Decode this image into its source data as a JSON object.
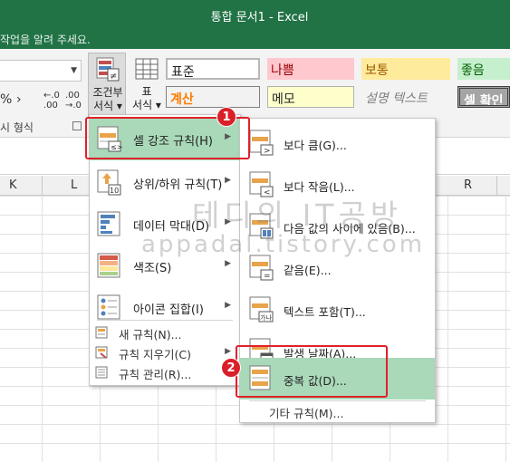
{
  "window": {
    "title": "통합 문서1 - Excel"
  },
  "tellme": {
    "text": "작업을 알려 주세요."
  },
  "ribbon": {
    "number_group_label": "시 형식",
    "percent_symbol": "%",
    "comma_symbol": "›",
    "increase_decimal": "←.0\n.00",
    "decrease_decimal": ".00\n→.0",
    "conditional_format_label": "조건부\n서식 ▾",
    "format_table_label": "표\n서식 ▾",
    "styles": [
      {
        "label": "표준"
      },
      {
        "label": "나쁨"
      },
      {
        "label": "보통"
      },
      {
        "label": "좋음"
      },
      {
        "label": "계산"
      },
      {
        "label": "메모"
      },
      {
        "label": "설명 텍스트"
      },
      {
        "label": "셀 확인"
      }
    ]
  },
  "columns": {
    "k": "K",
    "l": "L",
    "r": "R"
  },
  "menu_main": {
    "items": [
      {
        "label": "셀 강조 규칙(H)"
      },
      {
        "label": "상위/하위 규칙(T)"
      },
      {
        "label": "데이터 막대(D)"
      },
      {
        "label": "색조(S)"
      },
      {
        "label": "아이콘 집합(I)"
      }
    ],
    "small_items": [
      {
        "label": "새 규칙(N)..."
      },
      {
        "label": "규칙 지우기(C)"
      },
      {
        "label": "규칙 관리(R)..."
      }
    ]
  },
  "menu_sub": {
    "items": [
      {
        "label": "보다 큼(G)..."
      },
      {
        "label": "보다 작음(L)..."
      },
      {
        "label": "다음 값의 사이에 있음(B)..."
      },
      {
        "label": "같음(E)..."
      },
      {
        "label": "텍스트 포함(T)..."
      },
      {
        "label": "발생 날짜(A)..."
      },
      {
        "label": "중복 값(D)..."
      }
    ],
    "more": "기타 규칙(M)..."
  },
  "annotations": {
    "badge1": "1",
    "badge2": "2"
  },
  "watermark": {
    "line1": "테디의 IT공방",
    "line2": "appadal.tistory.com"
  },
  "colors": {
    "excel_green": "#217346",
    "highlight": "#a9d9b9",
    "callout_red": "#e0202a"
  }
}
